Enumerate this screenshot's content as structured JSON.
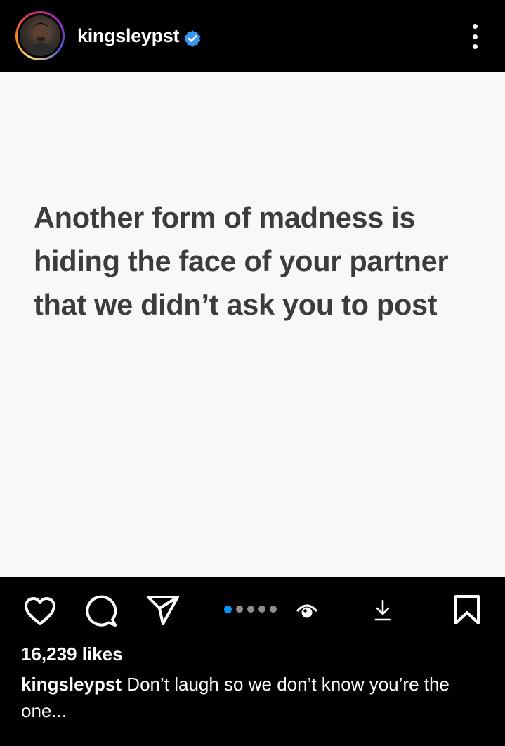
{
  "header": {
    "username": "kingsleypst",
    "verified_color": "#3897f0"
  },
  "post": {
    "text_lines": [
      "Another form of madness is",
      "hiding the face of your partner",
      "that we didn’t ask you to post"
    ]
  },
  "actions": {
    "carousel_total": 5,
    "carousel_active": 1,
    "accent": "#0095f6"
  },
  "likes": "16,239 likes",
  "caption": {
    "username": "kingsleypst",
    "text": " Don’t laugh so we don’t know you’re the one..."
  }
}
